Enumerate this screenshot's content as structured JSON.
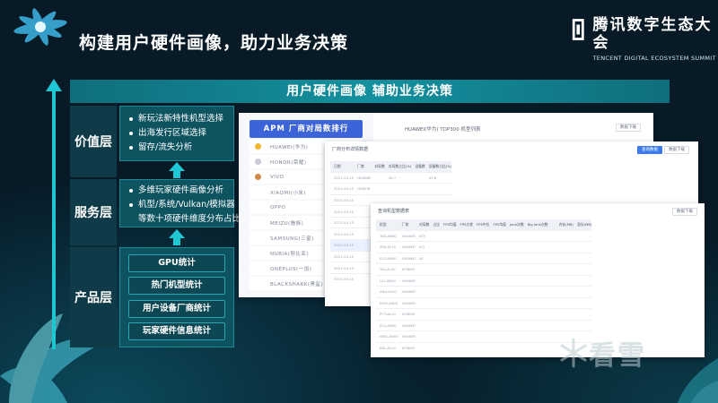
{
  "header": {
    "title": "构建用户硬件画像，助力业务决策"
  },
  "logo": {
    "name_cn": "腾讯数字生态大会",
    "name_en": "TENCENT DIGITAL ECOSYSTEM SUMMIT"
  },
  "banner": {
    "title": "用户硬件画像 辅助业务决策"
  },
  "layers": {
    "value": {
      "label": "价值层",
      "items": [
        "新玩法新特性机型选择",
        "出海发行区域选择",
        "留存/流失分析"
      ]
    },
    "service": {
      "label": "服务层",
      "items": [
        "多维玩家硬件画像分析",
        "机型/系统/Vulkan/模拟器",
        "等数十项硬件维度分布占比"
      ]
    },
    "product": {
      "label": "产品层",
      "buttons": [
        "GPU统计",
        "热门机型统计",
        "用户设备厂商统计",
        "玩家硬件信息统计"
      ]
    }
  },
  "screens": {
    "rank": {
      "title": "APM 厂商对局数排行",
      "top_caption": "HUAWEI(华为) TOP300 机型列表",
      "download": "数据下载",
      "rows": [
        "HUAWEI(华为)",
        "HONOR(荣耀)",
        "VIVO",
        "XIAOMI(小米)",
        "OPPO",
        "MEIZU(魅族)",
        "SAMSUNG(三星)",
        "NUBIA(努比亚)",
        "ONEPLUS(一加)",
        "BLACKSHARK(黑鲨)"
      ],
      "rank_colors": [
        "#f2b632",
        "#c9ccd4",
        "#d08a4a"
      ]
    },
    "vendor": {
      "title": "厂商分布详情数据",
      "query": "查询数据",
      "download": "数据下载",
      "headers": [
        "日期",
        "厂商",
        "对局数",
        "对局数占比(%)",
        "设备数",
        "设备数占比(%)"
      ],
      "rows": [
        [
          "2021-04-15",
          "HUAWEI",
          "",
          "45.7",
          "",
          "43.6"
        ],
        [
          "2021-04-15",
          "HONOR",
          "",
          "",
          "",
          ""
        ],
        [
          "2021-04-15",
          "",
          "",
          "",
          "",
          ""
        ],
        [
          "2021-04-15",
          "",
          "",
          "",
          "",
          ""
        ],
        [
          "2021-04-15",
          "",
          "",
          "",
          "",
          ""
        ],
        [
          "2021-04-15",
          "",
          "",
          "",
          "",
          ""
        ],
        [
          "2021-04-15",
          "",
          "",
          "",
          "",
          ""
        ],
        [
          "2021-04-15",
          "",
          "",
          "",
          "",
          ""
        ],
        [
          "2021-04-15",
          "",
          "",
          "",
          "",
          ""
        ],
        [
          "2021-04-15",
          "",
          "",
          "",
          "",
          ""
        ]
      ]
    },
    "model": {
      "title": "查询机型数据表",
      "download": "数据下载",
      "headers": [
        "机型",
        "厂商",
        "对局数",
        "占比",
        "FPS均值",
        "FPS方差",
        "FPS中位",
        "FPS均值",
        "Jank次数",
        "Big Jank次数",
        "",
        "",
        "内存(MB)",
        "显存(MB)"
      ],
      "rows": [
        [
          "TAS-AN00",
          "HUAWEI",
          "ATY",
          "",
          "",
          "",
          "",
          "",
          "",
          "",
          "",
          "",
          "",
          ""
        ],
        [
          "SEA-AL10",
          "HUAWEI",
          "ACI",
          "",
          "",
          "",
          "",
          "",
          "",
          "",
          "",
          "",
          "",
          ""
        ],
        [
          "ELS-AN00",
          "HUAWEI",
          "AY",
          "",
          "",
          "",
          "",
          "",
          "",
          "",
          "",
          "",
          "",
          ""
        ],
        [
          "YAL-AL00",
          "HONOR",
          "",
          "",
          "",
          "",
          "",
          "",
          "",
          "",
          "",
          "",
          "",
          ""
        ],
        [
          "LIO-AN00",
          "HUAWEI",
          "",
          "",
          "",
          "",
          "",
          "",
          "",
          "",
          "",
          "",
          "",
          ""
        ],
        [
          "ANA-AL00",
          "HUAWEI",
          "",
          "",
          "",
          "",
          "",
          "",
          "",
          "",
          "",
          "",
          "",
          ""
        ],
        [
          "NOH-AN00",
          "HUAWEI",
          "",
          "",
          "",
          "",
          "",
          "",
          "",
          "",
          "",
          "",
          "",
          ""
        ],
        [
          "PCT-AL10",
          "HONOR",
          "",
          "",
          "",
          "",
          "",
          "",
          "",
          "",
          "",
          "",
          "",
          ""
        ],
        [
          "ELS-AN00",
          "HUAWEI",
          "",
          "",
          "",
          "",
          "",
          "",
          "",
          "",
          "",
          "",
          "",
          ""
        ],
        [
          "WKG-AN00",
          "HUAWEI",
          "",
          "",
          "",
          "",
          "",
          "",
          "",
          "",
          "",
          "",
          "",
          ""
        ],
        [
          "BKL-AL20",
          "HONOR",
          "",
          "",
          "",
          "",
          "",
          "",
          "",
          "",
          "",
          "",
          "",
          ""
        ]
      ]
    }
  },
  "watermark": {
    "text": "看雪"
  },
  "colors": {
    "accent": "#1ec7d3",
    "box": "#0e5360",
    "banner": "#14909e",
    "rank_blue": "#3d63d8"
  }
}
